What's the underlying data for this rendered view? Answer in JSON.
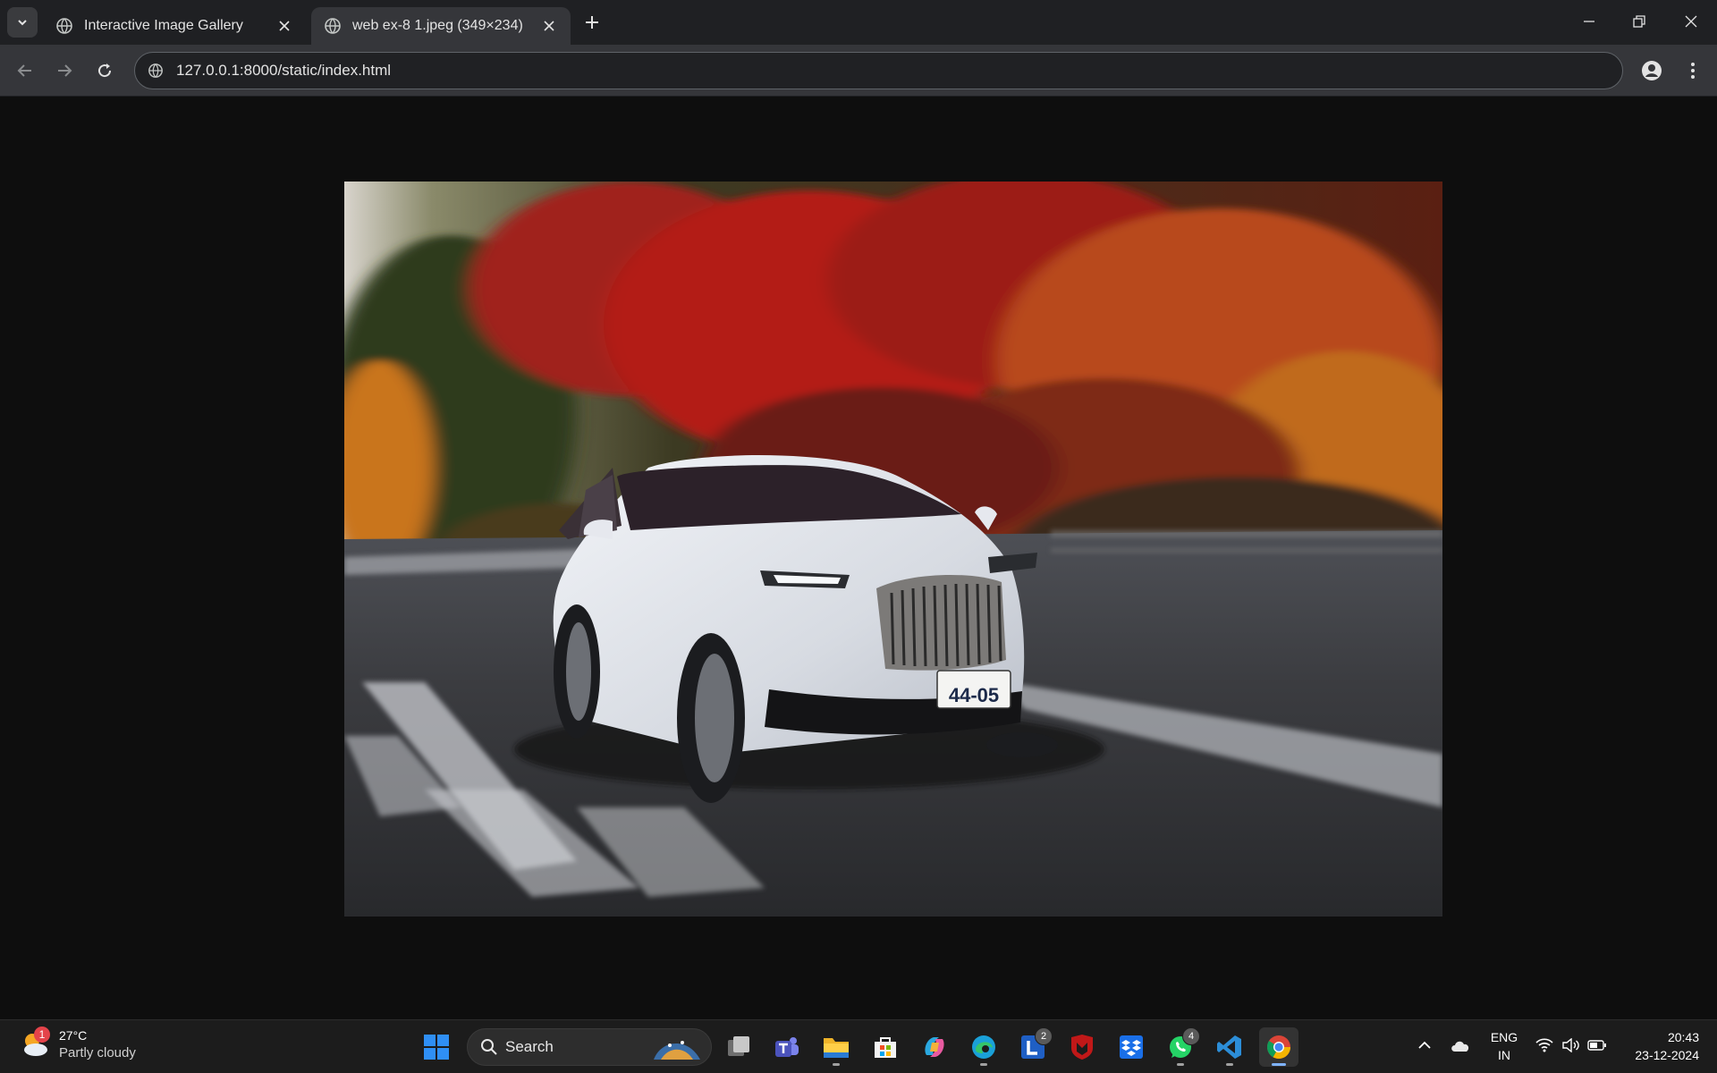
{
  "browser": {
    "tabs": [
      {
        "title": "Interactive Image Gallery",
        "active": false
      },
      {
        "title": "web ex-8 1.jpeg (349×234)",
        "active": true
      }
    ],
    "url": "127.0.0.1:8000/static/index.html"
  },
  "content": {
    "image_description": "White luxury sedan driving on a road with motion-blurred red and orange autumn trees",
    "plate_text": "44-05"
  },
  "taskbar": {
    "weather": {
      "temp": "27°C",
      "condition": "Partly cloudy",
      "badge": "1"
    },
    "search_label": "Search",
    "apps": [
      {
        "name": "task-view"
      },
      {
        "name": "teams"
      },
      {
        "name": "file-explorer"
      },
      {
        "name": "microsoft-store"
      },
      {
        "name": "copilot"
      },
      {
        "name": "edge"
      },
      {
        "name": "l-app",
        "badge": "2"
      },
      {
        "name": "mcafee"
      },
      {
        "name": "dropbox"
      },
      {
        "name": "whatsapp",
        "badge": "4"
      },
      {
        "name": "vscode"
      },
      {
        "name": "chrome"
      }
    ],
    "lang": {
      "line1": "ENG",
      "line2": "IN"
    },
    "time": "20:43",
    "date": "23-12-2024"
  },
  "colors": {
    "accent_windows": "#2f8ff5",
    "tab_active": "#35363a",
    "tab_strip": "#1f2023",
    "taskbar": "#1c1c1c"
  }
}
